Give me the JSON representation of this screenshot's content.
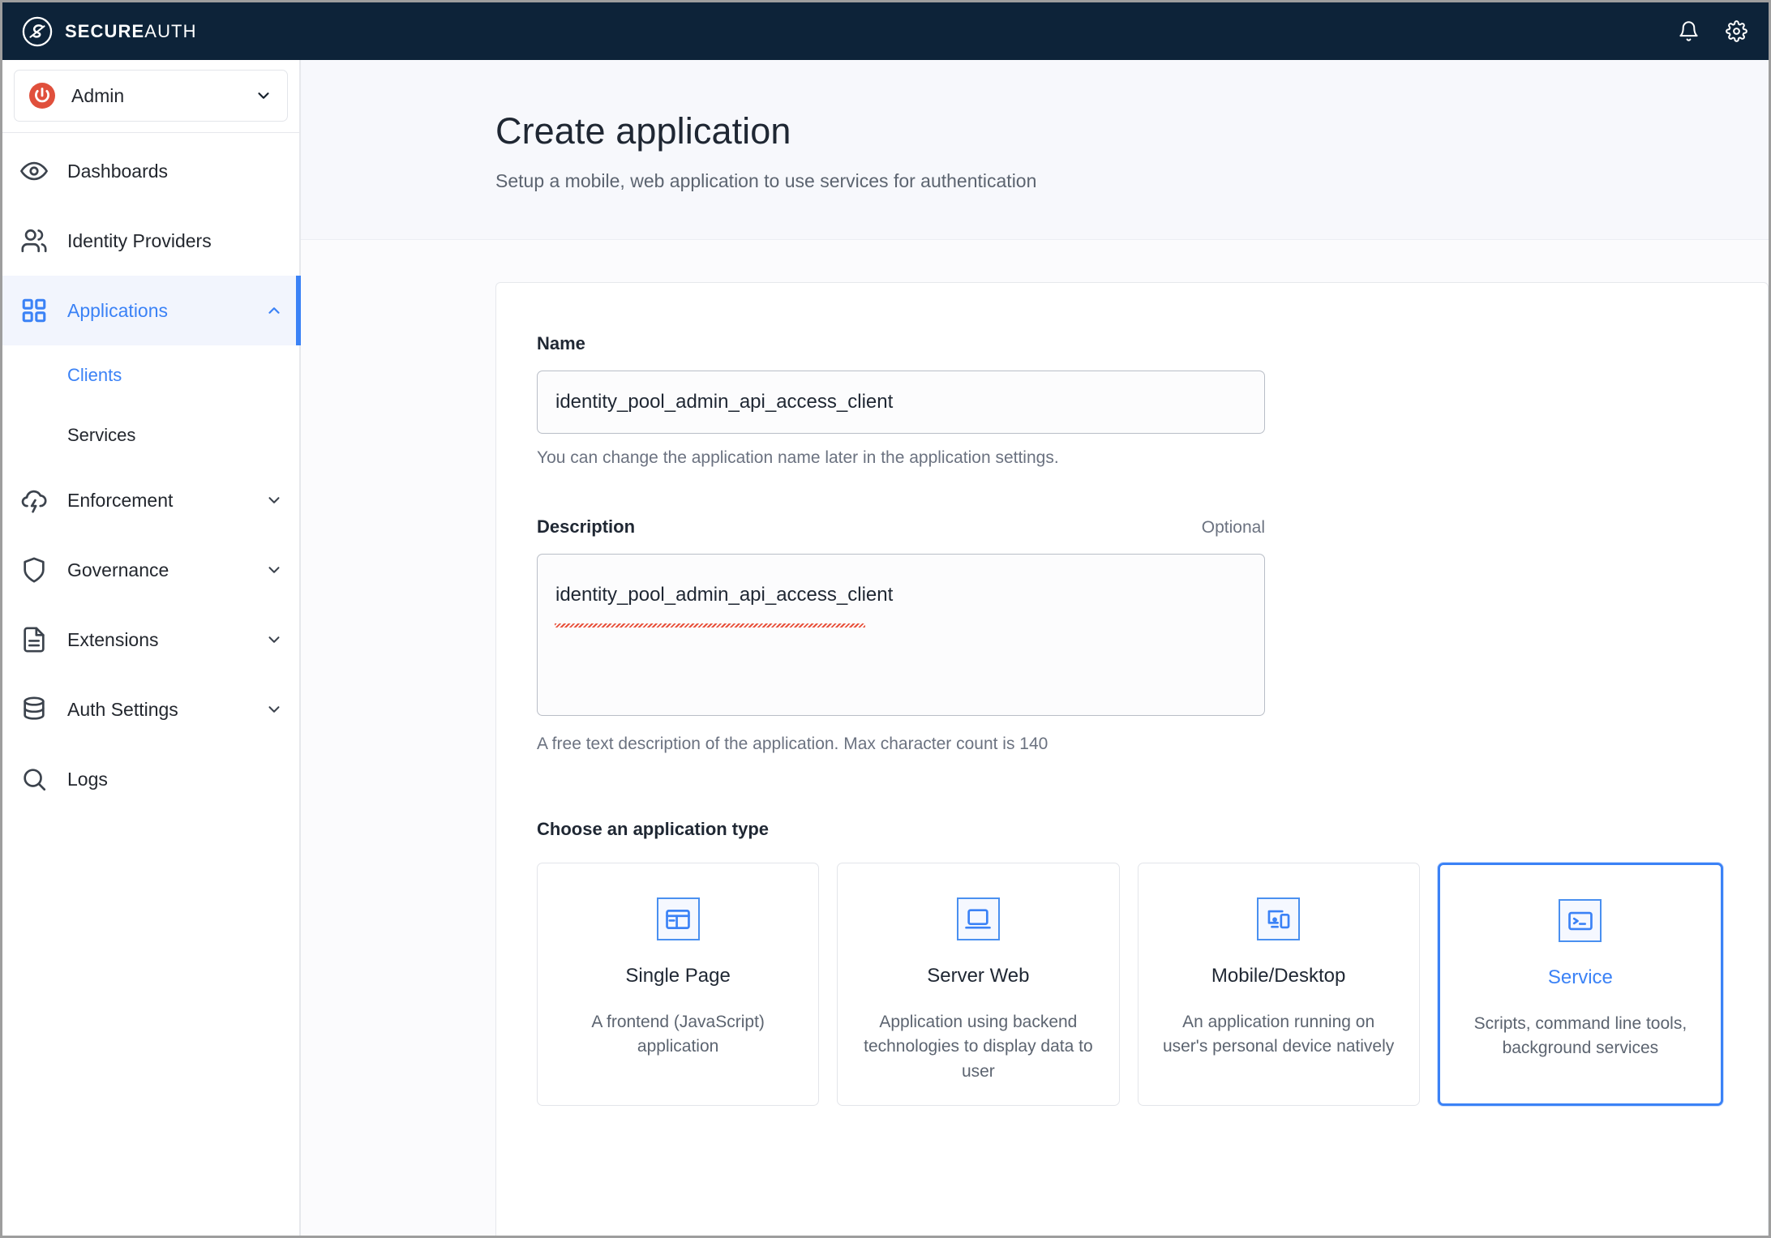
{
  "topbar": {
    "brand_strong": "SECURE",
    "brand_light": "AUTH",
    "logo_icon": "secureauth-logo-icon",
    "notifications_icon": "bell-icon",
    "settings_icon": "gear-icon"
  },
  "sidebar": {
    "account": {
      "label": "Admin",
      "icon": "power-icon",
      "chevron": "chevron-down-icon"
    },
    "items": [
      {
        "label": "Dashboards",
        "icon": "eye-icon",
        "active": false,
        "expandable": false
      },
      {
        "label": "Identity Providers",
        "icon": "users-icon",
        "active": false,
        "expandable": false
      },
      {
        "label": "Applications",
        "icon": "grid-icon",
        "active": true,
        "expandable": true,
        "chevron": "chevron-up-icon"
      },
      {
        "label": "Enforcement",
        "icon": "cloud-bolt-icon",
        "active": false,
        "expandable": true,
        "chevron": "chevron-down-icon"
      },
      {
        "label": "Governance",
        "icon": "shield-icon",
        "active": false,
        "expandable": true,
        "chevron": "chevron-down-icon"
      },
      {
        "label": "Extensions",
        "icon": "document-icon",
        "active": false,
        "expandable": true,
        "chevron": "chevron-down-icon"
      },
      {
        "label": "Auth Settings",
        "icon": "database-icon",
        "active": false,
        "expandable": true,
        "chevron": "chevron-down-icon"
      },
      {
        "label": "Logs",
        "icon": "search-icon",
        "active": false,
        "expandable": false
      }
    ],
    "sub_items": [
      {
        "label": "Clients",
        "active": true
      },
      {
        "label": "Services",
        "active": false
      }
    ]
  },
  "page": {
    "title": "Create application",
    "subtitle": "Setup a mobile, web application to use services for authentication"
  },
  "form": {
    "name": {
      "label": "Name",
      "value": "identity_pool_admin_api_access_client",
      "placeholder": "",
      "help": "You can change the application name later in the application settings."
    },
    "description": {
      "label": "Description",
      "optional": "Optional",
      "value": "identity_pool_admin_api_access_client",
      "placeholder": "",
      "help": "A free text description of the application. Max character count is 140"
    },
    "app_type": {
      "label": "Choose an application type",
      "options": [
        {
          "name": "Single Page",
          "description": "A frontend (JavaScript) application",
          "icon": "browser-layout-icon",
          "selected": false
        },
        {
          "name": "Server Web",
          "description": "Application using backend technologies to display data to user",
          "icon": "laptop-icon",
          "selected": false
        },
        {
          "name": "Mobile/Desktop",
          "description": "An application running on user's personal device natively",
          "icon": "devices-icon",
          "selected": false
        },
        {
          "name": "Service",
          "description": "Scripts, command line tools, background services",
          "icon": "terminal-icon",
          "selected": true
        }
      ]
    }
  },
  "colors": {
    "topbar_bg": "#0d2339",
    "accent_blue": "#3b82f6",
    "power_red": "#e0503c",
    "icon_blue": "#4a90f0"
  }
}
